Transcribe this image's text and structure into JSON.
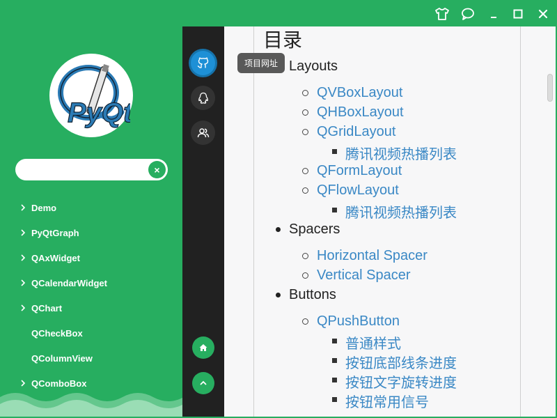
{
  "titlebar": {
    "buttons": [
      {
        "name": "skin-icon"
      },
      {
        "name": "feedback-icon"
      },
      {
        "name": "minimize-icon"
      },
      {
        "name": "maximize-icon"
      },
      {
        "name": "close-icon"
      }
    ]
  },
  "sidebar": {
    "logo_text": "PyQt",
    "search": {
      "value": "",
      "placeholder": "",
      "clear_glyph": "×"
    },
    "items": [
      {
        "label": "Demo",
        "expandable": true
      },
      {
        "label": "PyQtGraph",
        "expandable": true
      },
      {
        "label": "QAxWidget",
        "expandable": true
      },
      {
        "label": "QCalendarWidget",
        "expandable": true
      },
      {
        "label": "QChart",
        "expandable": true
      },
      {
        "label": "QCheckBox",
        "expandable": false
      },
      {
        "label": "QColumnView",
        "expandable": false
      },
      {
        "label": "QComboBox",
        "expandable": true
      }
    ]
  },
  "iconbar": {
    "top": [
      "github-icon",
      "qq-icon",
      "group-icon"
    ],
    "bottom": [
      "home-icon",
      "back-to-top-icon"
    ],
    "tooltip": "项目网址"
  },
  "content": {
    "title": "目录",
    "toc": {
      "layouts": "Layouts",
      "qvbox": "QVBoxLayout",
      "qhbox": "QHBoxLayout",
      "qgrid": "QGridLayout",
      "qgrid_sub": "腾讯视频热播列表",
      "qform": "QFormLayout",
      "qflow": "QFlowLayout",
      "qflow_sub": "腾讯视频热播列表",
      "spacers": "Spacers",
      "hspacer": "Horizontal Spacer",
      "vspacer": "Vertical Spacer",
      "buttons": "Buttons",
      "qpush": "QPushButton",
      "push_sub1": "普通样式",
      "push_sub2": "按钮底部线条进度",
      "push_sub3": "按钮文字旋转进度",
      "push_sub4": "按钮常用信号"
    }
  }
}
